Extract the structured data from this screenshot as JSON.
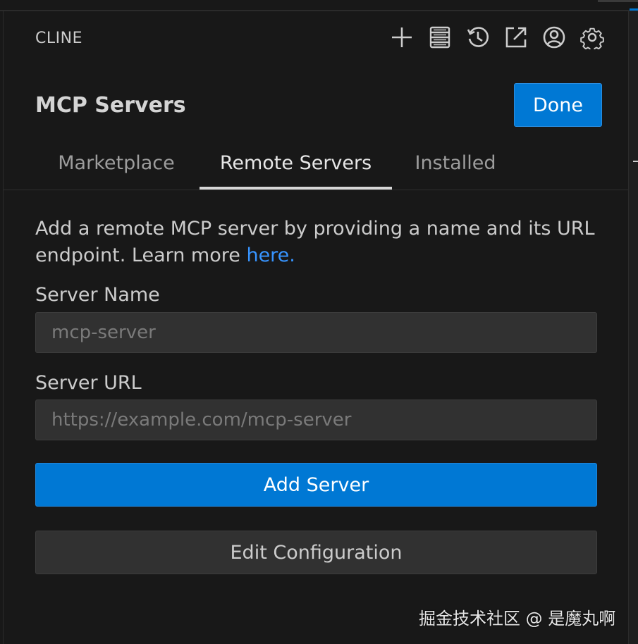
{
  "panel": {
    "title": "CLINE",
    "icons": [
      {
        "name": "plus-icon"
      },
      {
        "name": "server-icon"
      },
      {
        "name": "history-icon"
      },
      {
        "name": "external-link-icon"
      },
      {
        "name": "account-icon"
      },
      {
        "name": "gear-icon"
      }
    ]
  },
  "header": {
    "title": "MCP Servers",
    "done_label": "Done"
  },
  "tabs": [
    {
      "label": "Marketplace",
      "active": false
    },
    {
      "label": "Remote Servers",
      "active": true
    },
    {
      "label": "Installed",
      "active": false
    }
  ],
  "form": {
    "description": "Add a remote MCP server by providing a name and its URL endpoint. Learn more ",
    "learn_more_link": "here.",
    "server_name_label": "Server Name",
    "server_name_placeholder": "mcp-server",
    "server_name_value": "",
    "server_url_label": "Server URL",
    "server_url_placeholder": "https://example.com/mcp-server",
    "server_url_value": "",
    "add_server_label": "Add Server",
    "edit_configuration_label": "Edit Configuration"
  },
  "watermark": "掘金技术社区 @ 是魔丸啊",
  "colors": {
    "background": "#181818",
    "accent": "#0078d4",
    "link": "#3794ff",
    "input_bg": "#313131"
  }
}
